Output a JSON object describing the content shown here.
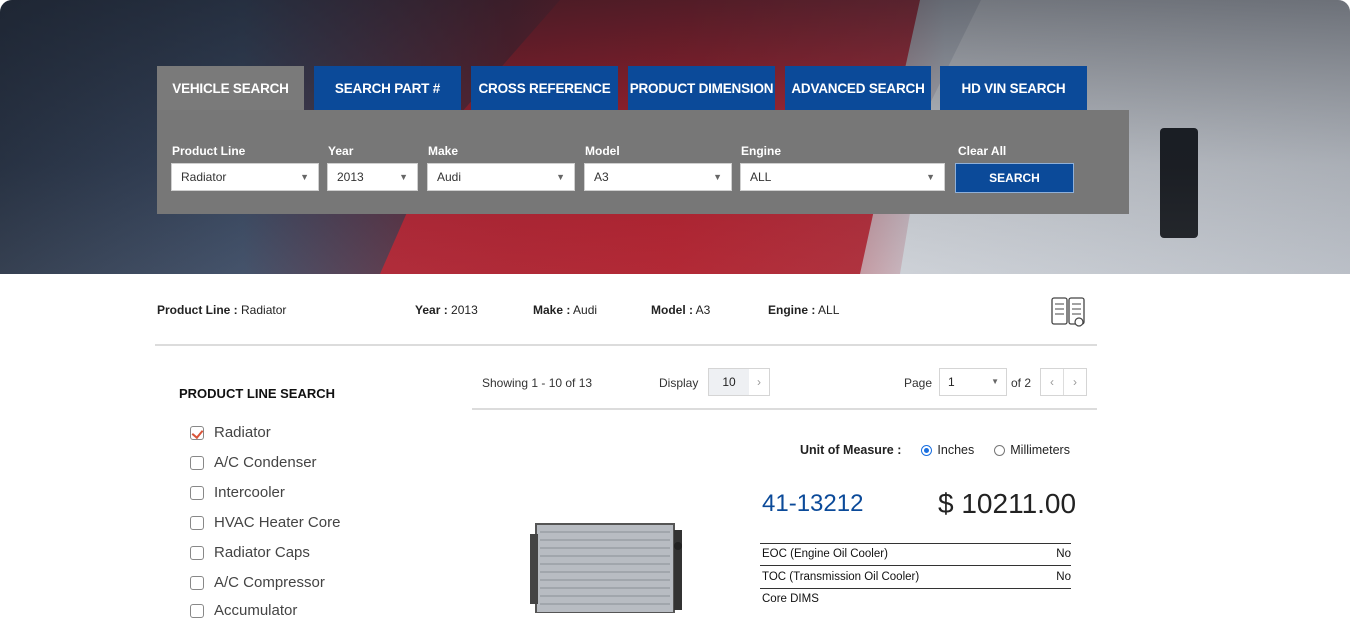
{
  "tabs": [
    {
      "label": "VEHICLE SEARCH",
      "active": true
    },
    {
      "label": "SEARCH PART #",
      "active": false
    },
    {
      "label": "CROSS REFERENCE",
      "active": false
    },
    {
      "label": "PRODUCT DIMENSION",
      "active": false
    },
    {
      "label": "ADVANCED SEARCH",
      "active": false
    },
    {
      "label": "HD VIN SEARCH",
      "active": false
    }
  ],
  "search_form": {
    "product_line_label": "Product Line",
    "product_line_value": "Radiator",
    "year_label": "Year",
    "year_value": "2013",
    "make_label": "Make",
    "make_value": "Audi",
    "model_label": "Model",
    "model_value": "A3",
    "engine_label": "Engine",
    "engine_value": "ALL",
    "clear_all_label": "Clear All",
    "search_label": "SEARCH"
  },
  "summary": {
    "product_line_key": "Product Line :",
    "product_line_val": "Radiator",
    "year_key": "Year :",
    "year_val": "2013",
    "make_key": "Make :",
    "make_val": "Audi",
    "model_key": "Model :",
    "model_val": "A3",
    "engine_key": "Engine :",
    "engine_val": "ALL"
  },
  "sidebar": {
    "title": "PRODUCT LINE SEARCH",
    "items": [
      {
        "label": "Radiator",
        "checked": true
      },
      {
        "label": "A/C Condenser",
        "checked": false
      },
      {
        "label": "Intercooler",
        "checked": false
      },
      {
        "label": "HVAC Heater Core",
        "checked": false
      },
      {
        "label": "Radiator Caps",
        "checked": false
      },
      {
        "label": "A/C Compressor",
        "checked": false
      },
      {
        "label": "Accumulator",
        "checked": false
      }
    ]
  },
  "results_toolbar": {
    "showing": "Showing 1 - 10 of 13",
    "display_label": "Display",
    "display_value": "10",
    "page_label": "Page",
    "page_value": "1",
    "page_of": "of 2"
  },
  "unit_of_measure": {
    "label": "Unit of Measure :",
    "options": [
      {
        "label": "Inches",
        "selected": true
      },
      {
        "label": "Millimeters",
        "selected": false
      }
    ]
  },
  "product": {
    "part_number": "41-13212",
    "price": "$ 10211.00",
    "specs": [
      {
        "name": "EOC (Engine Oil Cooler)",
        "value": "No"
      },
      {
        "name": "TOC (Transmission Oil Cooler)",
        "value": "No"
      },
      {
        "name": "Core DIMS",
        "value": ""
      }
    ]
  },
  "colors": {
    "brand_blue": "#0b4a99",
    "panel_gray": "#777777",
    "check_accent": "#d9553a"
  }
}
